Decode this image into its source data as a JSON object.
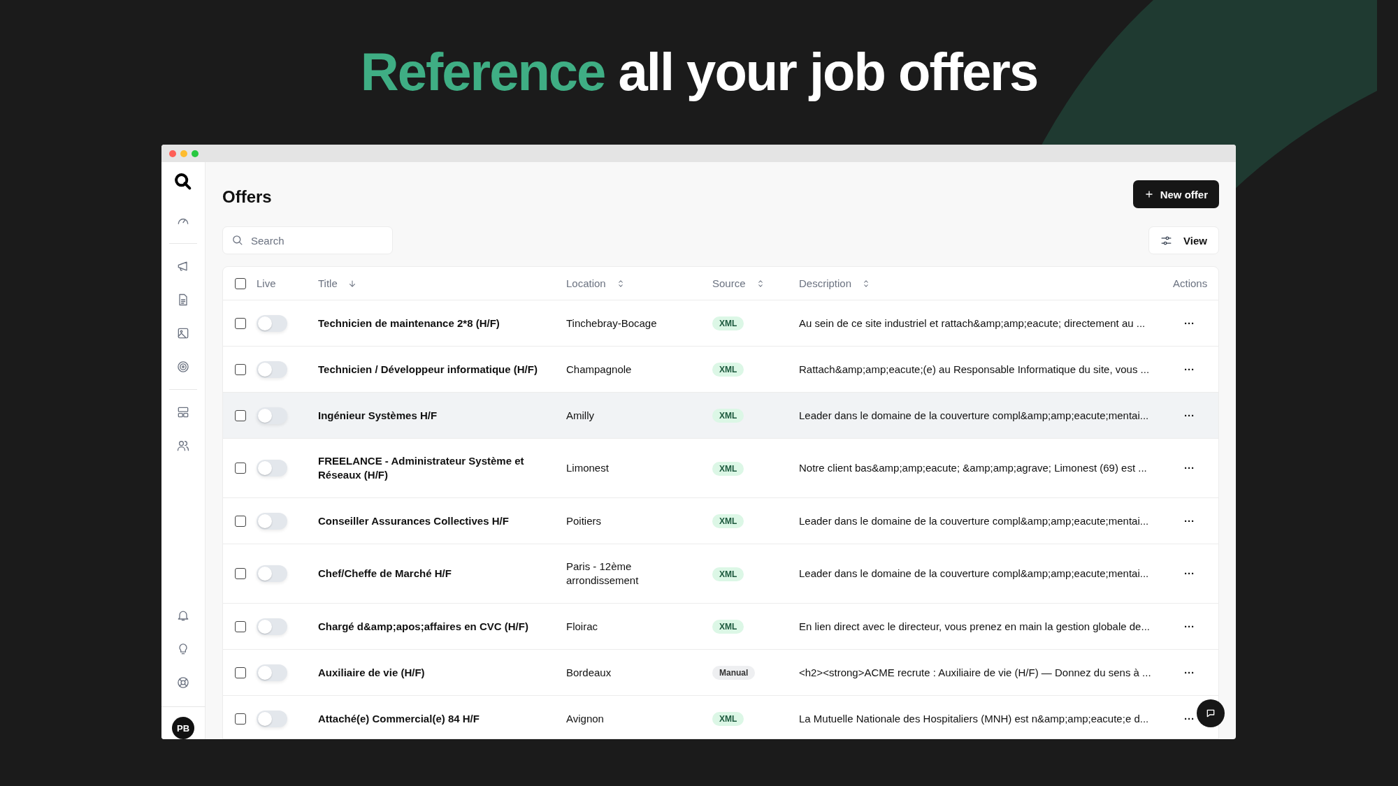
{
  "headline": {
    "accent": "Reference",
    "rest": "all your job offers"
  },
  "page": {
    "title": "Offers",
    "new_button": "New offer",
    "search": {
      "placeholder": "Search"
    },
    "view_button": "View"
  },
  "table": {
    "select_all_checked": false,
    "columns": [
      {
        "label": "Live",
        "sortable": false
      },
      {
        "label": "Title",
        "sortable": true,
        "sorted": true
      },
      {
        "label": "Location",
        "sortable": true,
        "sorted": false
      },
      {
        "label": "Source",
        "sortable": true,
        "sorted": false
      },
      {
        "label": "Description",
        "sortable": true,
        "sorted": false
      },
      {
        "label": "Actions",
        "sortable": false
      }
    ],
    "rows": [
      {
        "checked": false,
        "live": false,
        "highlighted": false,
        "title": "Technicien de maintenance 2*8 (H/F)",
        "location": "Tinchebray-Bocage",
        "source": {
          "label": "XML",
          "kind": "xml"
        },
        "description": "Au sein de ce site industriel et rattach&amp;amp;eacute; directement au ...",
        "actions": "···"
      },
      {
        "checked": false,
        "live": false,
        "highlighted": false,
        "title": "Technicien / Développeur informatique (H/F)",
        "location": "Champagnole",
        "source": {
          "label": "XML",
          "kind": "xml"
        },
        "description": "Rattach&amp;amp;eacute;(e) au Responsable Informatique du site, vous ...",
        "actions": "···"
      },
      {
        "checked": false,
        "live": false,
        "highlighted": true,
        "title": "Ingénieur Systèmes H/F",
        "location": "Amilly",
        "source": {
          "label": "XML",
          "kind": "xml"
        },
        "description": "Leader dans le domaine de la couverture compl&amp;amp;eacute;mentai...",
        "actions": "···"
      },
      {
        "checked": false,
        "live": false,
        "highlighted": false,
        "title": "FREELANCE - Administrateur Système et Réseaux (H/F)",
        "location": "Limonest",
        "source": {
          "label": "XML",
          "kind": "xml"
        },
        "description": "Notre client bas&amp;amp;eacute; &amp;amp;agrave; Limonest (69) est ...",
        "actions": "···"
      },
      {
        "checked": false,
        "live": false,
        "highlighted": false,
        "title": "Conseiller Assurances Collectives H/F",
        "location": "Poitiers",
        "source": {
          "label": "XML",
          "kind": "xml"
        },
        "description": "Leader dans le domaine de la couverture compl&amp;amp;eacute;mentai...",
        "actions": "···"
      },
      {
        "checked": false,
        "live": false,
        "highlighted": false,
        "title": "Chef/Cheffe de Marché H/F",
        "location": "Paris - 12ème arrondissement",
        "source": {
          "label": "XML",
          "kind": "xml"
        },
        "description": "Leader dans le domaine de la couverture compl&amp;amp;eacute;mentai...",
        "actions": "···"
      },
      {
        "checked": false,
        "live": false,
        "highlighted": false,
        "title": "Chargé d&amp;apos;affaires en CVC (H/F)",
        "location": "Floirac",
        "source": {
          "label": "XML",
          "kind": "xml"
        },
        "description": "En lien direct avec le directeur, vous prenez en main la gestion globale de...",
        "actions": "···"
      },
      {
        "checked": false,
        "live": false,
        "highlighted": false,
        "title": "Auxiliaire de vie (H/F)",
        "location": "Bordeaux",
        "source": {
          "label": "Manual",
          "kind": "manual"
        },
        "description": "<h2><strong>ACME recrute : Auxiliaire de vie (H/F) — Donnez du sens à ...",
        "actions": "···"
      },
      {
        "checked": false,
        "live": false,
        "highlighted": false,
        "title": "Attaché(e) Commercial(e) 84 H/F",
        "location": "Avignon",
        "source": {
          "label": "XML",
          "kind": "xml"
        },
        "description": "La Mutuelle Nationale des Hospitaliers (MNH) est n&amp;amp;eacute;e d...",
        "actions": "···"
      }
    ]
  },
  "user": {
    "initials": "PB"
  }
}
